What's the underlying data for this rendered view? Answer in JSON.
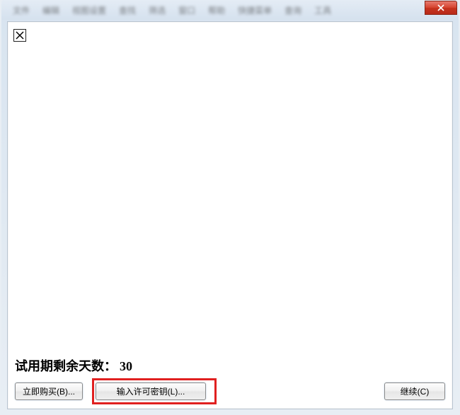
{
  "titlebar": {
    "menu_items": [
      "文件",
      "编辑",
      "视图设置",
      "查找",
      "筛选",
      "窗口",
      "帮助",
      "快捷菜单",
      "查询",
      "工具"
    ]
  },
  "dialog": {
    "trial_label": "试用期剩余天数：",
    "trial_days": "30",
    "buttons": {
      "buy_now": "立即购买(B)...",
      "enter_license": "输入许可密钥(L)...",
      "continue": "继续(C)"
    }
  }
}
